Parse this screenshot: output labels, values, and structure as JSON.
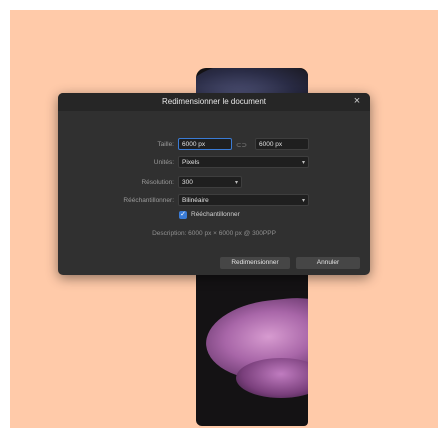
{
  "dialog": {
    "title": "Redimensionner le document",
    "close_glyph": "×",
    "size": {
      "label": "Taille:",
      "width_value": "6000 px",
      "link_glyph": "⊂⊃",
      "height_value": "6000 px"
    },
    "units": {
      "label": "Unités:",
      "value": "Pixels"
    },
    "resolution": {
      "label": "Résolution:",
      "value": "300"
    },
    "resample": {
      "label": "Rééchantillonner:",
      "value": "Bilinéaire",
      "checkbox_label": "Rééchantillonner",
      "checked": true
    },
    "description": "Description: 6000 px × 6000 px @ 300PPP",
    "buttons": {
      "resize": "Redimensionner",
      "cancel": "Annuler"
    }
  },
  "icons": {
    "close": "close-icon",
    "link": "link-icon",
    "dropdown": "chevron-down-icon",
    "check": "checkmark-icon"
  },
  "colors": {
    "canvas_background": "#ffcaa9",
    "dialog_background": "#303030",
    "accent": "#3a7bd5"
  }
}
